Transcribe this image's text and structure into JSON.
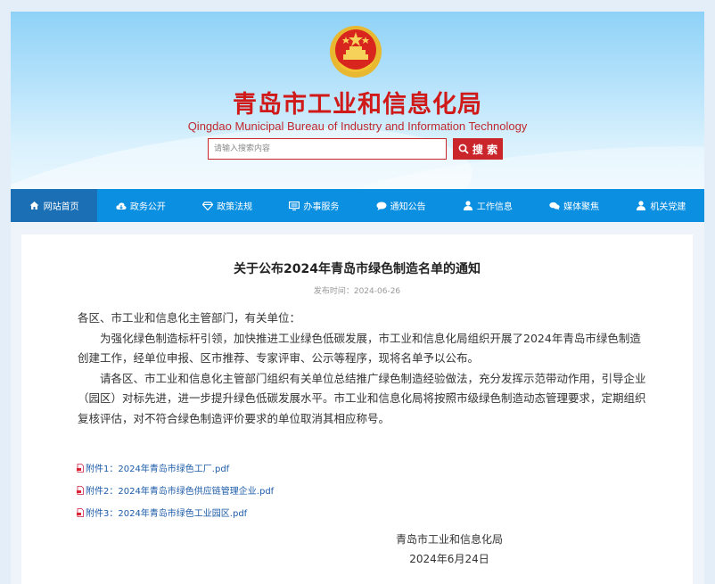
{
  "header": {
    "title": "青岛市工业和信息化局",
    "subtitle": "Qingdao Municipal Bureau of Industry and Information Technology",
    "search_placeholder": "请输入搜索内容",
    "search_label": "搜 索",
    "emblem_icon": "national-emblem-icon"
  },
  "nav": [
    {
      "label": "网站首页",
      "icon": "home-icon",
      "active": true
    },
    {
      "label": "政务公开",
      "icon": "cloud-icon"
    },
    {
      "label": "政策法规",
      "icon": "diamond-icon"
    },
    {
      "label": "办事服务",
      "icon": "monitor-icon"
    },
    {
      "label": "通知公告",
      "icon": "chat-icon"
    },
    {
      "label": "工作信息",
      "icon": "user-icon"
    },
    {
      "label": "媒体聚焦",
      "icon": "chat-bubbles-icon"
    },
    {
      "label": "机关党建",
      "icon": "user-icon"
    }
  ],
  "article": {
    "title": "关于公布2024年青岛市绿色制造名单的通知",
    "publish_time": "发布时间：2024-06-26",
    "salutation": "各区、市工业和信息化主管部门，有关单位：",
    "para1": "为强化绿色制造标杆引领，加快推进工业绿色低碳发展，市工业和信息化局组织开展了2024年青岛市绿色制造创建工作，经单位申报、区市推荐、专家评审、公示等程序，现将名单予以公布。",
    "para2": "请各区、市工业和信息化主管部门组织有关单位总结推广绿色制造经验做法，充分发挥示范带动作用，引导企业（园区）对标先进，进一步提升绿色低碳发展水平。市工业和信息化局将按照市级绿色制造动态管理要求，定期组织复核评估，对不符合绿色制造评价要求的单位取消其相应称号。",
    "attachments": [
      "附件1：2024年青岛市绿色工厂.pdf",
      "附件2：2024年青岛市绿色供应链管理企业.pdf",
      "附件3：2024年青岛市绿色工业园区.pdf"
    ],
    "signature": "青岛市工业和信息化局",
    "date": "2024年6月24日"
  },
  "colors": {
    "brand_red": "#d01a1a",
    "nav_blue": "#0b8fe0",
    "nav_active": "#1b6fb5",
    "link_blue": "#1c5ba8"
  }
}
